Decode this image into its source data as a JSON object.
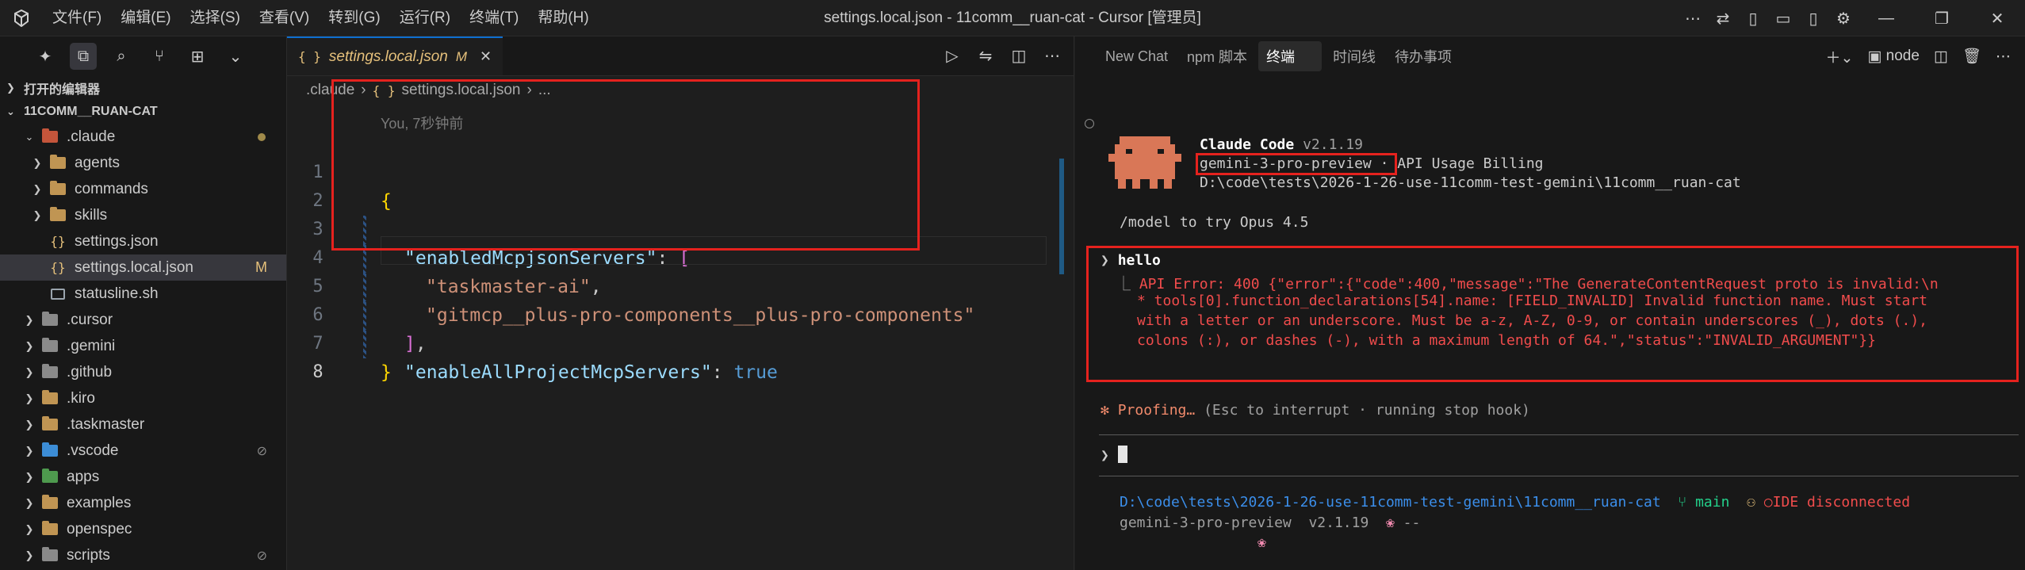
{
  "titlebar": {
    "menu": [
      "文件(F)",
      "编辑(E)",
      "选择(S)",
      "查看(V)",
      "转到(G)",
      "运行(R)",
      "终端(T)",
      "帮助(H)"
    ],
    "window_title": "settings.local.json - 11comm__ruan-cat - Cursor [管理员]"
  },
  "sidebar": {
    "open_editors_label": "打开的编辑器",
    "workspace_label": "11COMM__RUAN-CAT",
    "items": [
      {
        "label": ".claude",
        "type": "folder",
        "expanded": true,
        "level": 1
      },
      {
        "label": "agents",
        "type": "folder",
        "level": 2
      },
      {
        "label": "commands",
        "type": "folder",
        "level": 2
      },
      {
        "label": "skills",
        "type": "folder",
        "level": 2
      },
      {
        "label": "settings.json",
        "type": "json",
        "level": 2
      },
      {
        "label": "settings.local.json",
        "type": "json",
        "level": 2,
        "badge": "M"
      },
      {
        "label": "statusline.sh",
        "type": "sh",
        "level": 2
      },
      {
        "label": ".cursor",
        "type": "folder",
        "level": 1
      },
      {
        "label": ".gemini",
        "type": "folder",
        "level": 1
      },
      {
        "label": ".github",
        "type": "folder",
        "level": 1
      },
      {
        "label": ".kiro",
        "type": "folder",
        "level": 1
      },
      {
        "label": ".taskmaster",
        "type": "folder",
        "level": 1
      },
      {
        "label": ".vscode",
        "type": "folder",
        "level": 1
      },
      {
        "label": "apps",
        "type": "folder",
        "level": 1
      },
      {
        "label": "examples",
        "type": "folder",
        "level": 1
      },
      {
        "label": "openspec",
        "type": "folder",
        "level": 1
      },
      {
        "label": "scripts",
        "type": "folder",
        "level": 1
      }
    ]
  },
  "editor": {
    "tab_icon": "{ }",
    "tab_label": "settings.local.json",
    "tab_modified": "M",
    "breadcrumb": [
      ".claude",
      "{ }",
      "settings.local.json",
      "..."
    ],
    "blame": "You, 7秒钟前",
    "line_numbers": [
      "1",
      "2",
      "3",
      "4",
      "5",
      "6",
      "7",
      "8"
    ],
    "code": {
      "l1": "{",
      "l2_key": "\"enabledMcpjsonServers\"",
      "l2_rest": ": ",
      "l2_bracket": "[",
      "l3_str": "\"taskmaster-ai\"",
      "l3_rest": ",",
      "l4_str": "\"gitmcp__plus-pro-components__plus-pro-components\"",
      "l5_bracket": "]",
      "l5_rest": ",",
      "l6_key": "\"enableAllProjectMcpServers\"",
      "l6_rest": ": ",
      "l6_bool": "true",
      "l7": "}"
    }
  },
  "panel": {
    "tabs": [
      "New Chat",
      "npm 脚本",
      "终端",
      "时间线",
      "待办事项"
    ],
    "active_tab": "终端",
    "terminal_name": "node",
    "terminal": {
      "app_name": "Claude Code",
      "version": "v2.1.19",
      "model": "gemini-3-pro-preview",
      "billing": " · API Usage Billing",
      "cwd": "D:\\code\\tests\\2026-1-26-use-11comm-test-gemini\\11comm__ruan-cat",
      "hint": "/model to try Opus 4.5",
      "prompt_symbol": "❯",
      "user_input": "hello",
      "error_lines": [
        "API Error: 400 {\"error\":{\"code\":400,\"message\":\"The GenerateContentRequest proto is invalid:\\n",
        "* tools[0].function_declarations[54].name: [FIELD_INVALID] Invalid function name. Must start",
        "with a letter or an underscore. Must be a-z, A-Z, 0-9, or contain underscores (_), dots (.),",
        "colons (:), or dashes (-), with a maximum length of 64.\",\"status\":\"INVALID_ARGUMENT\"}}"
      ],
      "status_star": "✻",
      "status_word": "Proofing…",
      "status_hint": "(Esc to interrupt · running stop hook)",
      "footer_path": "D:\\code\\tests\\2026-1-26-use-11comm-test-gemini\\11comm__ruan-cat",
      "branch": "main",
      "ide_status": "IDE disconnected",
      "footer_model": "gemini-3-pro-preview",
      "footer_version": "v2.1.19",
      "footer_dash": "--"
    }
  }
}
